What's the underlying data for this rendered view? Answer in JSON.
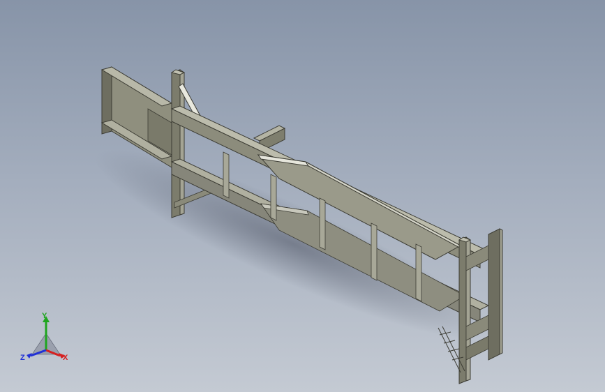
{
  "viewport": {
    "background_top": "#8794a8",
    "background_bottom": "#c4cad3"
  },
  "model": {
    "description_icon": "conveyor-frame-model",
    "steel_color": "#8a8a78",
    "steel_dark": "#5e5e50",
    "steel_light": "#b4b4a4"
  },
  "triad": {
    "x_label": "X",
    "y_label": "Y",
    "z_label": "Z",
    "x_color": "#d62020",
    "y_color": "#1fa51f",
    "z_color": "#2030d6"
  }
}
